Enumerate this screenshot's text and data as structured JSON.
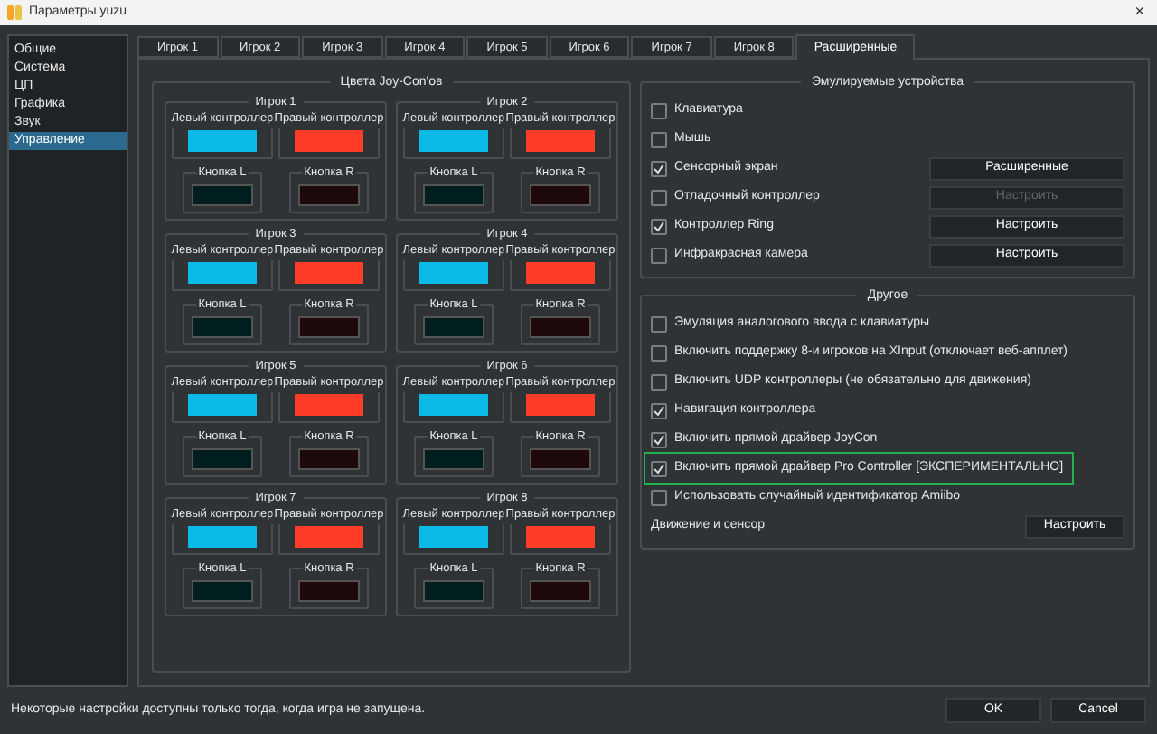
{
  "window": {
    "title": "Параметры yuzu",
    "close": "×"
  },
  "sidebar": {
    "items": [
      {
        "label": "Общие",
        "selected": false
      },
      {
        "label": "Система",
        "selected": false
      },
      {
        "label": "ЦП",
        "selected": false
      },
      {
        "label": "Графика",
        "selected": false
      },
      {
        "label": "Звук",
        "selected": false
      },
      {
        "label": "Управление",
        "selected": true
      }
    ]
  },
  "tabs": [
    {
      "label": "Игрок 1",
      "selected": false
    },
    {
      "label": "Игрок 2",
      "selected": false
    },
    {
      "label": "Игрок 3",
      "selected": false
    },
    {
      "label": "Игрок 4",
      "selected": false
    },
    {
      "label": "Игрок 5",
      "selected": false
    },
    {
      "label": "Игрок 6",
      "selected": false
    },
    {
      "label": "Игрок 7",
      "selected": false
    },
    {
      "label": "Игрок 8",
      "selected": false
    },
    {
      "label": "Расширенные",
      "selected": true
    }
  ],
  "joycon_colors": {
    "title": "Цвета Joy-Con'ов",
    "players": [
      {
        "title": "Игрок 1",
        "swatches": [
          {
            "label": "Левый контроллер",
            "color": "#0ab9e6"
          },
          {
            "label": "Правый контроллер",
            "color": "#ff3c28"
          },
          {
            "label": "Кнопка L",
            "color": "#001e1e"
          },
          {
            "label": "Кнопка R",
            "color": "#1e0a0a"
          }
        ]
      },
      {
        "title": "Игрок 2",
        "swatches": [
          {
            "label": "Левый контроллер",
            "color": "#0ab9e6"
          },
          {
            "label": "Правый контроллер",
            "color": "#ff3c28"
          },
          {
            "label": "Кнопка L",
            "color": "#001e1e"
          },
          {
            "label": "Кнопка R",
            "color": "#1e0a0a"
          }
        ]
      },
      {
        "title": "Игрок 3",
        "swatches": [
          {
            "label": "Левый контроллер",
            "color": "#0ab9e6"
          },
          {
            "label": "Правый контроллер",
            "color": "#ff3c28"
          },
          {
            "label": "Кнопка L",
            "color": "#001e1e"
          },
          {
            "label": "Кнопка R",
            "color": "#1e0a0a"
          }
        ]
      },
      {
        "title": "Игрок 4",
        "swatches": [
          {
            "label": "Левый контроллер",
            "color": "#0ab9e6"
          },
          {
            "label": "Правый контроллер",
            "color": "#ff3c28"
          },
          {
            "label": "Кнопка L",
            "color": "#001e1e"
          },
          {
            "label": "Кнопка R",
            "color": "#1e0a0a"
          }
        ]
      },
      {
        "title": "Игрок 5",
        "swatches": [
          {
            "label": "Левый контроллер",
            "color": "#0ab9e6"
          },
          {
            "label": "Правый контроллер",
            "color": "#ff3c28"
          },
          {
            "label": "Кнопка L",
            "color": "#001e1e"
          },
          {
            "label": "Кнопка R",
            "color": "#1e0a0a"
          }
        ]
      },
      {
        "title": "Игрок 6",
        "swatches": [
          {
            "label": "Левый контроллер",
            "color": "#0ab9e6"
          },
          {
            "label": "Правый контроллер",
            "color": "#ff3c28"
          },
          {
            "label": "Кнопка L",
            "color": "#001e1e"
          },
          {
            "label": "Кнопка R",
            "color": "#1e0a0a"
          }
        ]
      },
      {
        "title": "Игрок 7",
        "swatches": [
          {
            "label": "Левый контроллер",
            "color": "#0ab9e6"
          },
          {
            "label": "Правый контроллер",
            "color": "#ff3c28"
          },
          {
            "label": "Кнопка L",
            "color": "#001e1e"
          },
          {
            "label": "Кнопка R",
            "color": "#1e0a0a"
          }
        ]
      },
      {
        "title": "Игрок 8",
        "swatches": [
          {
            "label": "Левый контроллер",
            "color": "#0ab9e6"
          },
          {
            "label": "Правый контроллер",
            "color": "#ff3c28"
          },
          {
            "label": "Кнопка L",
            "color": "#001e1e"
          },
          {
            "label": "Кнопка R",
            "color": "#1e0a0a"
          }
        ]
      }
    ]
  },
  "emulated_devices": {
    "title": "Эмулируемые устройства",
    "items": [
      {
        "kind": "checkbox",
        "label": "Клавиатура",
        "checked": false
      },
      {
        "kind": "checkbox",
        "label": "Мышь",
        "checked": false
      },
      {
        "kind": "checkbox",
        "label": "Сенсорный экран",
        "checked": true,
        "button": {
          "label": "Расширенные",
          "disabled": false
        }
      },
      {
        "kind": "checkbox",
        "label": "Отладочный контроллер",
        "checked": false,
        "button": {
          "label": "Настроить",
          "disabled": true
        }
      },
      {
        "kind": "checkbox",
        "label": "Контроллер Ring",
        "checked": true,
        "button": {
          "label": "Настроить",
          "disabled": false
        }
      },
      {
        "kind": "checkbox",
        "label": "Инфракрасная камера",
        "checked": false,
        "button": {
          "label": "Настроить",
          "disabled": false
        }
      }
    ]
  },
  "other": {
    "title": "Другое",
    "items": [
      {
        "kind": "checkbox",
        "label": "Эмуляция аналогового ввода с клавиатуры",
        "checked": false,
        "highlighted": false
      },
      {
        "kind": "checkbox",
        "label": "Включить поддержку 8-и игроков на XInput (отключает веб-апплет)",
        "checked": false,
        "highlighted": false
      },
      {
        "kind": "checkbox",
        "label": "Включить UDP контроллеры (не обязательно для движения)",
        "checked": false,
        "highlighted": false
      },
      {
        "kind": "checkbox",
        "label": "Навигация контроллера",
        "checked": true,
        "highlighted": false
      },
      {
        "kind": "checkbox",
        "label": "Включить прямой драйвер JoyCon",
        "checked": true,
        "highlighted": false
      },
      {
        "kind": "checkbox",
        "label": "Включить прямой драйвер Pro Controller [ЭКСПЕРИМЕНТАЛЬНО]",
        "checked": true,
        "highlighted": true
      },
      {
        "kind": "checkbox",
        "label": "Использовать случайный идентификатор Amiibo",
        "checked": false,
        "highlighted": false
      },
      {
        "kind": "label",
        "label": "Движение и сенсор",
        "button": {
          "label": "Настроить",
          "disabled": false
        }
      }
    ]
  },
  "status_bar": {
    "message": "Некоторые настройки доступны только тогда, когда игра не запущена."
  },
  "buttons": [
    "OK",
    "Cancel"
  ]
}
